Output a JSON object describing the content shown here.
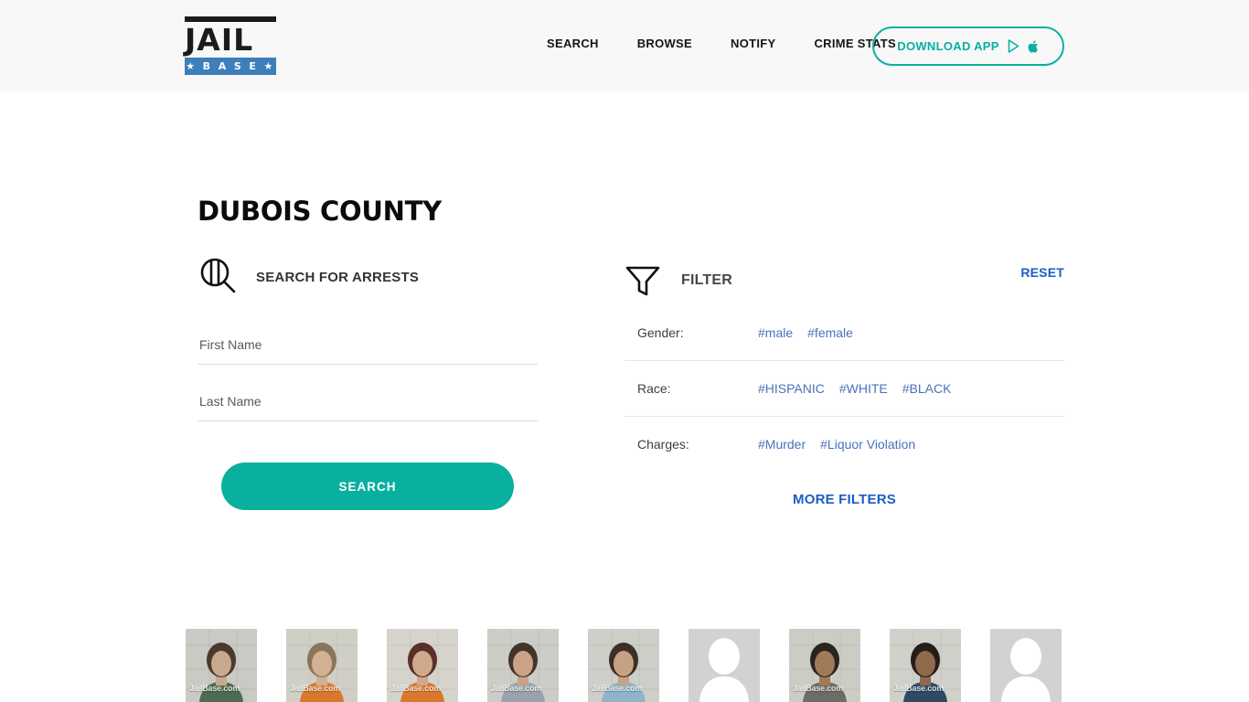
{
  "header": {
    "logo": {
      "top_word": "JAIL",
      "bottom_word": "★ B A S E ★",
      "accent_color": "#3d7ebb"
    },
    "nav": [
      {
        "label": "SEARCH"
      },
      {
        "label": "BROWSE"
      },
      {
        "label": "NOTIFY"
      },
      {
        "label": "CRIME STATS"
      }
    ],
    "download_button": {
      "label": "DOWNLOAD APP",
      "accent_color": "#09b0a0",
      "icons": [
        "google-play-icon",
        "apple-icon"
      ]
    }
  },
  "page": {
    "title": "DUBOIS COUNTY"
  },
  "search_panel": {
    "icon": "jail-magnifier-icon",
    "heading": "SEARCH FOR ARRESTS",
    "first_name": {
      "placeholder": "First Name",
      "value": ""
    },
    "last_name": {
      "placeholder": "Last Name",
      "value": ""
    },
    "submit_label": "SEARCH",
    "submit_color": "#09b0a0"
  },
  "filter_panel": {
    "icon": "funnel-icon",
    "heading": "FILTER",
    "reset_label": "RESET",
    "reset_color": "#1a5fc4",
    "tag_color": "#4a72b8",
    "rows": [
      {
        "label": "Gender:",
        "tags": [
          "#male",
          "#female"
        ]
      },
      {
        "label": "Race:",
        "tags": [
          "#HISPANIC",
          "#WHITE",
          "#BLACK"
        ]
      },
      {
        "label": "Charges:",
        "tags": [
          "#Murder",
          "#Liquor Violation"
        ]
      }
    ],
    "more_filters_label": "MORE FILTERS"
  },
  "thumbnails": {
    "watermark": "JailBase.com",
    "items": [
      {
        "type": "mugshot",
        "wall": "#c8cac3",
        "skin": "#c9a98e",
        "hair": "#4a3a2c",
        "shirt": "#4e6b52",
        "has_watermark": true
      },
      {
        "type": "mugshot",
        "wall": "#cfcfc6",
        "skin": "#d2b193",
        "hair": "#8a7559",
        "shirt": "#d8792c",
        "has_watermark": true
      },
      {
        "type": "mugshot",
        "wall": "#d5d3cb",
        "skin": "#cfa98c",
        "hair": "#5a2f28",
        "shirt": "#d8792c",
        "has_watermark": true
      },
      {
        "type": "mugshot",
        "wall": "#cbcdc6",
        "skin": "#caa287",
        "hair": "#43342a",
        "shirt": "#9aa3ad",
        "has_watermark": true
      },
      {
        "type": "mugshot",
        "wall": "#cdcfc8",
        "skin": "#c6a184",
        "hair": "#3b2f26",
        "shirt": "#8fb4c9",
        "has_watermark": true
      },
      {
        "type": "placeholder",
        "has_watermark": false
      },
      {
        "type": "mugshot",
        "wall": "#cbcdc5",
        "skin": "#a07a58",
        "hair": "#2b2320",
        "shirt": "#6d6b66",
        "has_watermark": true
      },
      {
        "type": "mugshot",
        "wall": "#cfd1ca",
        "skin": "#8f6a4c",
        "hair": "#241d1a",
        "shirt": "#2f4a63",
        "has_watermark": true
      },
      {
        "type": "placeholder",
        "has_watermark": false
      }
    ]
  }
}
